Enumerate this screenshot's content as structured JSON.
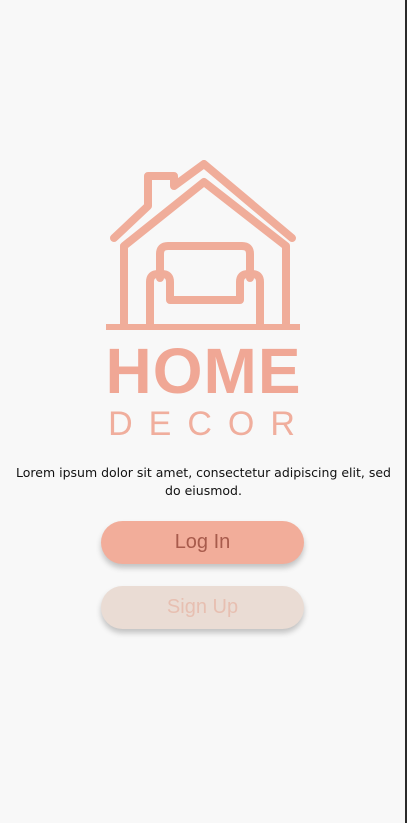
{
  "brand": {
    "title": "HOME",
    "subtitle": "DECOR",
    "logo_icon": "house-sofa-logo-icon",
    "accent_color": "#f0a795"
  },
  "intro": {
    "description": "Lorem ipsum dolor sit amet, consectetur adipiscing elit, sed do eiusmod."
  },
  "actions": {
    "login_label": "Log In",
    "signup_label": "Sign Up"
  }
}
